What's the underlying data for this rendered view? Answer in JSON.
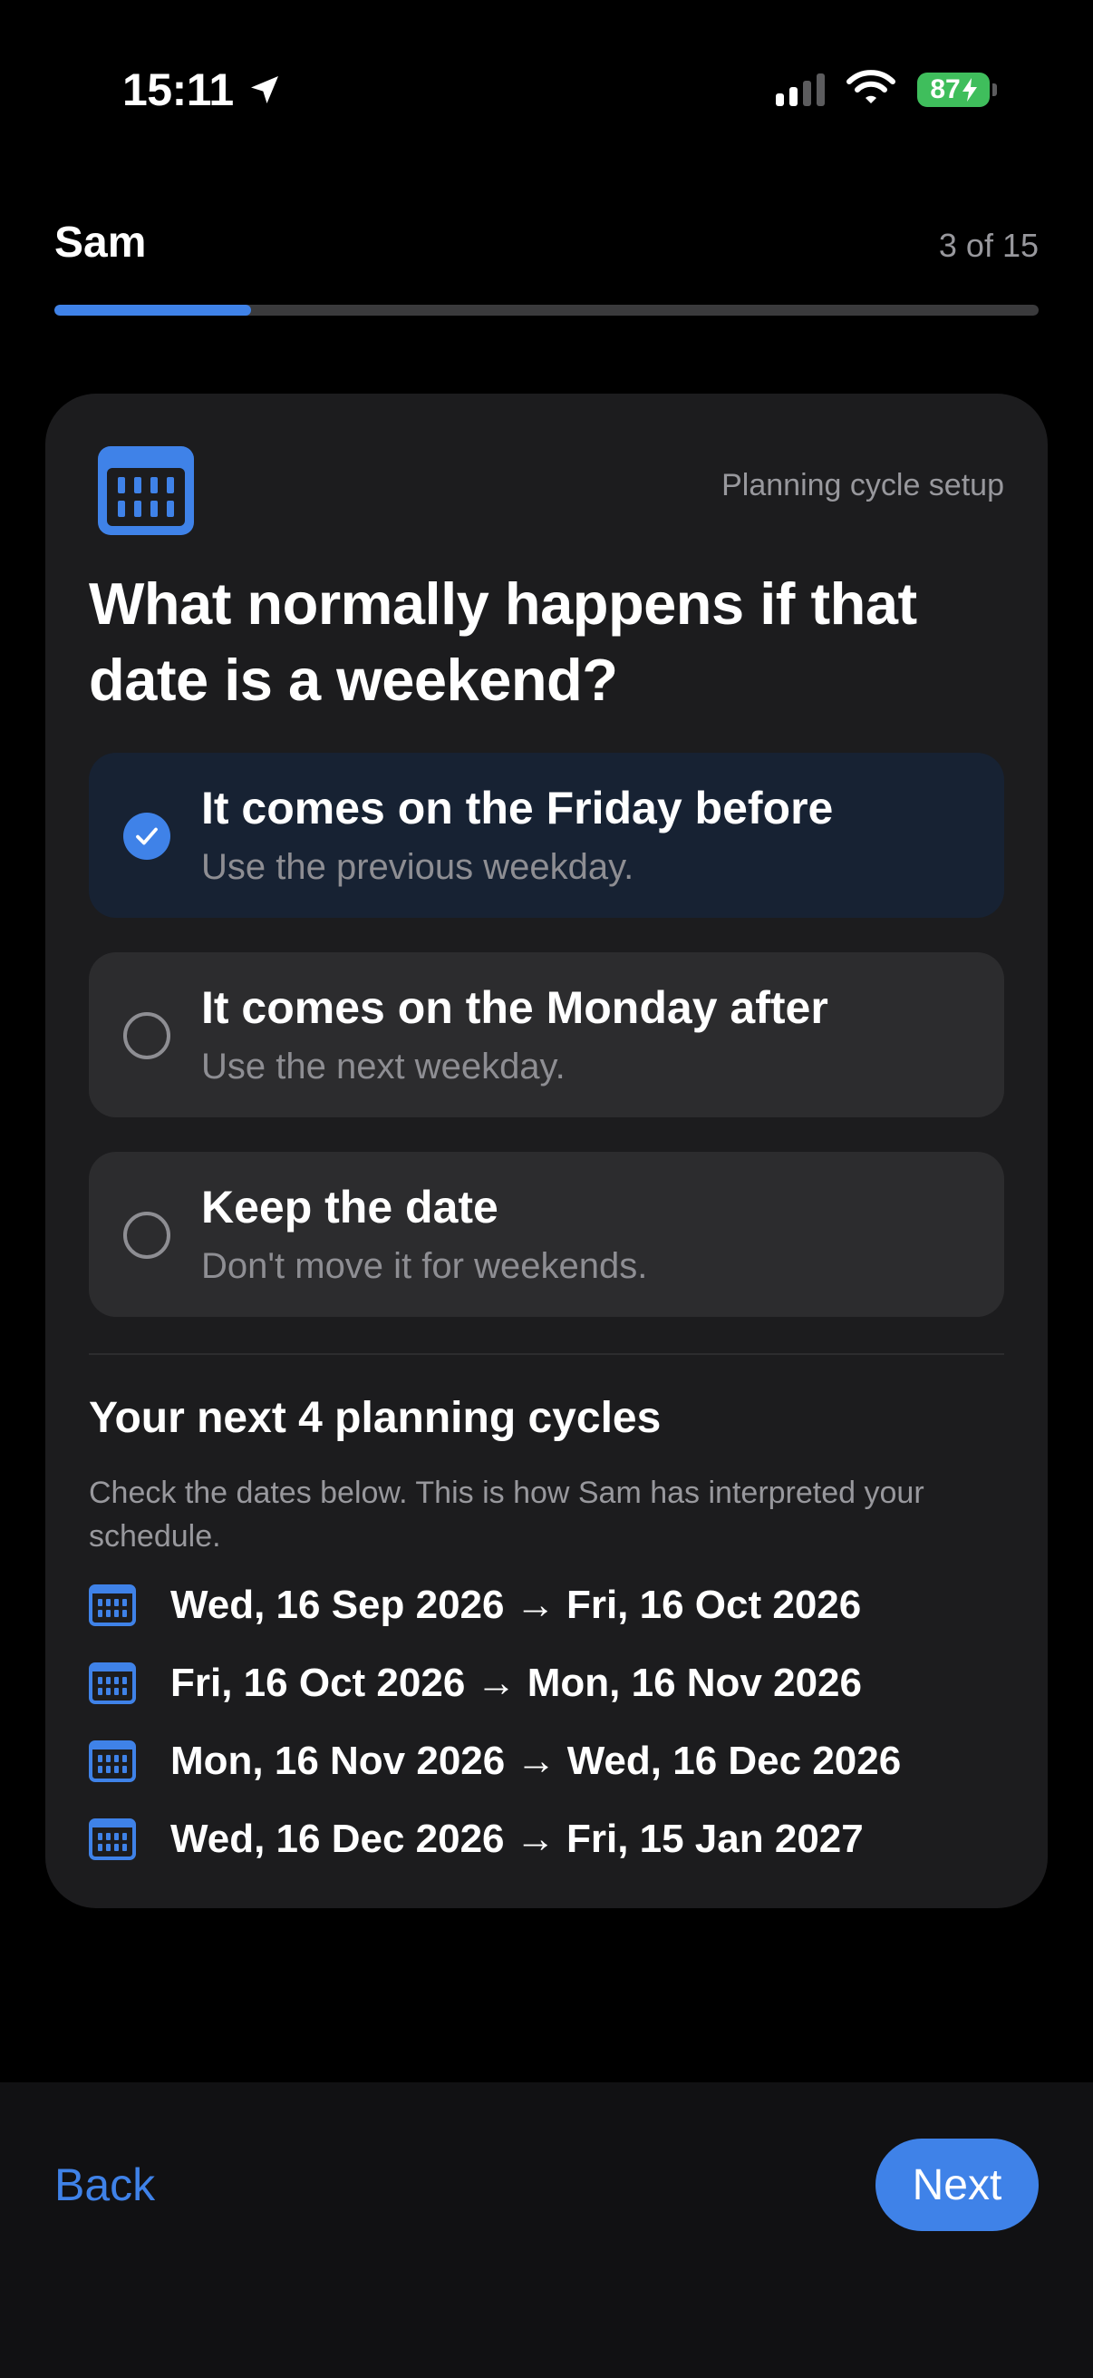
{
  "status_bar": {
    "time": "15:11",
    "battery": "87"
  },
  "header": {
    "title": "Sam",
    "step": "3 of 15",
    "progress_fraction": 0.2
  },
  "card": {
    "kicker": "Planning cycle setup",
    "question": "What normally happens if that date is a weekend?",
    "options": [
      {
        "title": "It comes on the Friday before",
        "subtitle": "Use the previous weekday.",
        "selected": true
      },
      {
        "title": "It comes on the Monday after",
        "subtitle": "Use the next weekday.",
        "selected": false
      },
      {
        "title": "Keep the date",
        "subtitle": "Don't move it for weekends.",
        "selected": false
      }
    ],
    "cycles_title": "Your next 4 planning cycles",
    "cycles_description": "Check the dates below. This is how Sam has interpreted your schedule.",
    "cycles": [
      "Wed, 16 Sep 2026 → Fri, 16 Oct 2026",
      "Fri, 16 Oct 2026 → Mon, 16 Nov 2026",
      "Mon, 16 Nov 2026 → Wed, 16 Dec 2026",
      "Wed, 16 Dec 2026 → Fri, 15 Jan 2027"
    ]
  },
  "footer": {
    "back_label": "Back",
    "next_label": "Next"
  },
  "colors": {
    "accent": "#3f82e8",
    "background": "#000000",
    "card": "#1c1c1e",
    "battery": "#3fbe5c"
  }
}
